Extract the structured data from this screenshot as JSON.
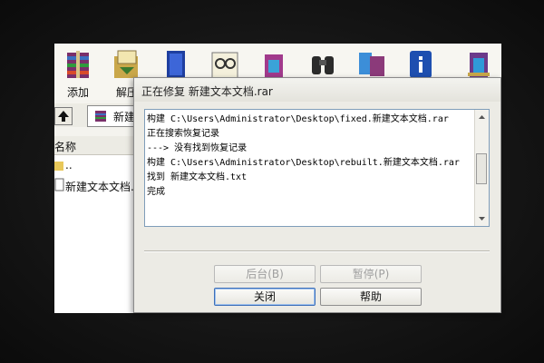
{
  "toolbar": {
    "buttons": [
      {
        "label": "添加",
        "icon": "archive-add-icon"
      },
      {
        "label": "解压",
        "icon": "extract-icon"
      },
      {
        "label": "",
        "icon": "test-icon"
      },
      {
        "label": "",
        "icon": "view-icon"
      },
      {
        "label": "",
        "icon": "delete-icon"
      },
      {
        "label": "",
        "icon": "find-icon"
      },
      {
        "label": "",
        "icon": "wizard-icon"
      },
      {
        "label": "",
        "icon": "info-icon"
      },
      {
        "label": "",
        "icon": "repair-icon"
      }
    ]
  },
  "address": {
    "text": "新建"
  },
  "file_list": {
    "column_name": "名称",
    "rows": [
      {
        "name": ".."
      },
      {
        "name": "新建文本文档."
      }
    ]
  },
  "dialog": {
    "title": "正在修复 新建文本文档.rar",
    "log": [
      "构建 C:\\Users\\Administrator\\Desktop\\fixed.新建文本文档.rar",
      "正在搜索恢复记录",
      "---> 没有找到恢复记录",
      "构建 C:\\Users\\Administrator\\Desktop\\rebuilt.新建文本文档.rar",
      "找到 新建文本文档.txt",
      "完成"
    ],
    "buttons": {
      "background": "后台(B)",
      "pause": "暂停(P)",
      "close": "关闭",
      "help": "帮助"
    }
  }
}
